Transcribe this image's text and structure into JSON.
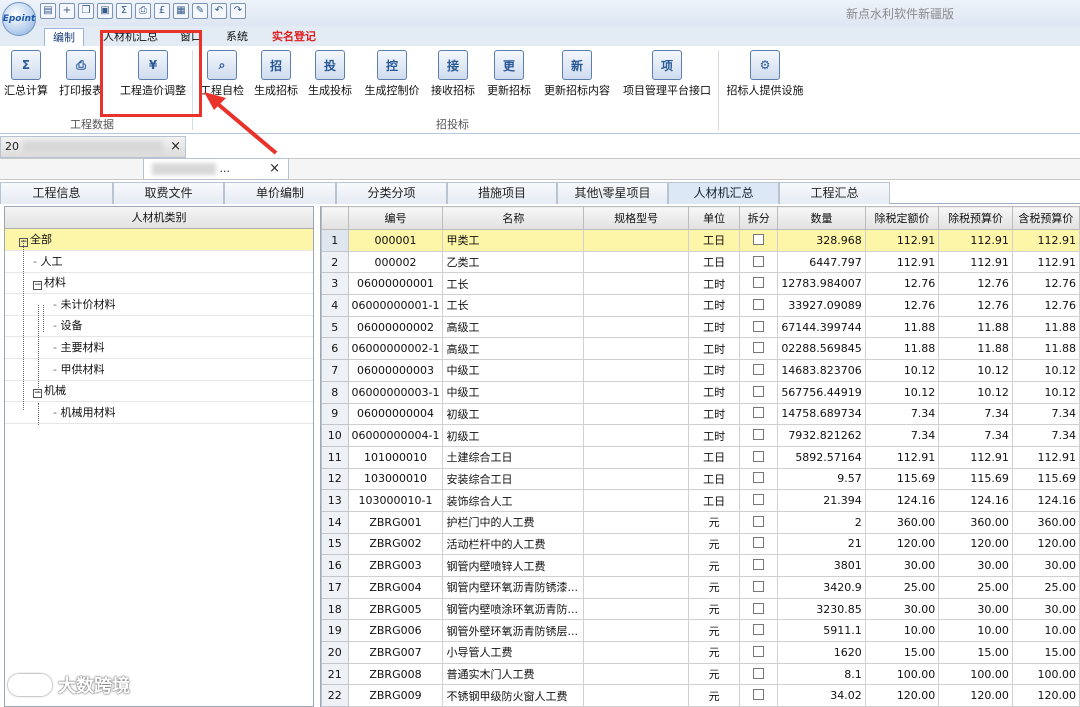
{
  "app": {
    "logo_text": "Epoint",
    "title": "新点水利软件新疆版"
  },
  "quick_access": [
    "new-doc-icon",
    "add-icon",
    "open-icon",
    "save-icon",
    "sum-icon",
    "print-icon",
    "money-icon",
    "calc-icon",
    "edit-icon",
    "undo-icon",
    "redo-icon"
  ],
  "ribbon_tabs": [
    {
      "label": "编制",
      "active": true
    },
    {
      "label": "人材机汇总"
    },
    {
      "label": "窗口"
    },
    {
      "label": "系统"
    },
    {
      "label": "实名登记",
      "highlight": "#e02020"
    }
  ],
  "ribbon": {
    "buttons": [
      {
        "label": "汇总计算",
        "glyph": "Σ"
      },
      {
        "label": "打印报表",
        "glyph": "⎙"
      },
      {
        "label": "工程造价调整",
        "glyph": "¥"
      },
      {
        "label": "工程自检",
        "glyph": "⌕"
      },
      {
        "label": "生成招标",
        "glyph": "招"
      },
      {
        "label": "生成投标",
        "glyph": "投"
      },
      {
        "label": "生成控制价",
        "glyph": "控"
      },
      {
        "label": "接收招标",
        "glyph": "接"
      },
      {
        "label": "更新招标",
        "glyph": "更"
      },
      {
        "label": "更新招标内容",
        "glyph": "新"
      },
      {
        "label": "项目管理平台接口",
        "glyph": "项"
      },
      {
        "label": "招标人提供设施",
        "glyph": "⚙"
      }
    ],
    "groups": [
      "工程数据",
      "招投标"
    ]
  },
  "doc_tabs": [
    {
      "label_prefix": "20",
      "close": "×"
    },
    {
      "label_suffix": "...",
      "close": "×"
    }
  ],
  "main_tabs": [
    {
      "label": "工程信息"
    },
    {
      "label": "取费文件"
    },
    {
      "label": "单价编制"
    },
    {
      "label": "分类分项"
    },
    {
      "label": "措施项目"
    },
    {
      "label": "其他\\零星项目"
    },
    {
      "label": "人材机汇总",
      "active": true
    },
    {
      "label": "工程汇总"
    }
  ],
  "tree": {
    "header": "人材机类别",
    "nodes": [
      {
        "label": "全部",
        "selected": true,
        "expander": "−"
      },
      {
        "label": "人工"
      },
      {
        "label": "材料",
        "expander": "−"
      },
      {
        "label": "未计价材料"
      },
      {
        "label": "设备"
      },
      {
        "label": "主要材料"
      },
      {
        "label": "甲供材料"
      },
      {
        "label": "机械",
        "expander": "−"
      },
      {
        "label": "机械用材料"
      }
    ]
  },
  "grid": {
    "columns": [
      "",
      "编号",
      "名称",
      "规格型号",
      "单位",
      "拆分",
      "数量",
      "除税定额价",
      "除税预算价",
      "含税预算价"
    ],
    "rows": [
      [
        "1",
        "000001",
        "甲类工",
        "",
        "工日",
        "",
        "328.968",
        "112.91",
        "112.91",
        "112.91"
      ],
      [
        "2",
        "000002",
        "乙类工",
        "",
        "工日",
        "",
        "6447.797",
        "112.91",
        "112.91",
        "112.91"
      ],
      [
        "3",
        "06000000001",
        "工长",
        "",
        "工时",
        "",
        "12783.984007",
        "12.76",
        "12.76",
        "12.76"
      ],
      [
        "4",
        "06000000001-1",
        "工长",
        "",
        "工时",
        "",
        "33927.09089",
        "12.76",
        "12.76",
        "12.76"
      ],
      [
        "5",
        "06000000002",
        "高级工",
        "",
        "工时",
        "",
        "67144.399744",
        "11.88",
        "11.88",
        "11.88"
      ],
      [
        "6",
        "06000000002-1",
        "高级工",
        "",
        "工时",
        "",
        "02288.569845",
        "11.88",
        "11.88",
        "11.88"
      ],
      [
        "7",
        "06000000003",
        "中级工",
        "",
        "工时",
        "",
        "14683.823706",
        "10.12",
        "10.12",
        "10.12"
      ],
      [
        "8",
        "06000000003-1",
        "中级工",
        "",
        "工时",
        "",
        "567756.44919",
        "10.12",
        "10.12",
        "10.12"
      ],
      [
        "9",
        "06000000004",
        "初级工",
        "",
        "工时",
        "",
        "14758.689734",
        "7.34",
        "7.34",
        "7.34"
      ],
      [
        "10",
        "06000000004-1",
        "初级工",
        "",
        "工时",
        "",
        "7932.821262",
        "7.34",
        "7.34",
        "7.34"
      ],
      [
        "11",
        "101000010",
        "土建综合工日",
        "",
        "工日",
        "",
        "5892.57164",
        "112.91",
        "112.91",
        "112.91"
      ],
      [
        "12",
        "103000010",
        "安装综合工日",
        "",
        "工日",
        "",
        "9.57",
        "115.69",
        "115.69",
        "115.69"
      ],
      [
        "13",
        "103000010-1",
        "装饰综合人工",
        "",
        "工日",
        "",
        "21.394",
        "124.16",
        "124.16",
        "124.16"
      ],
      [
        "14",
        "ZBRG001",
        "护栏门中的人工费",
        "",
        "元",
        "",
        "2",
        "360.00",
        "360.00",
        "360.00"
      ],
      [
        "15",
        "ZBRG002",
        "活动栏杆中的人工费",
        "",
        "元",
        "",
        "21",
        "120.00",
        "120.00",
        "120.00"
      ],
      [
        "16",
        "ZBRG003",
        "钢管内壁喷锌人工费",
        "",
        "元",
        "",
        "3801",
        "30.00",
        "30.00",
        "30.00"
      ],
      [
        "17",
        "ZBRG004",
        "钢管内壁环氧沥青防锈漆...",
        "",
        "元",
        "",
        "3420.9",
        "25.00",
        "25.00",
        "25.00"
      ],
      [
        "18",
        "ZBRG005",
        "钢管内壁喷涂环氧沥青防...",
        "",
        "元",
        "",
        "3230.85",
        "30.00",
        "30.00",
        "30.00"
      ],
      [
        "19",
        "ZBRG006",
        "钢管外壁环氧沥青防锈层...",
        "",
        "元",
        "",
        "5911.1",
        "10.00",
        "10.00",
        "10.00"
      ],
      [
        "20",
        "ZBRG007",
        "小导管人工费",
        "",
        "元",
        "",
        "1620",
        "15.00",
        "15.00",
        "15.00"
      ],
      [
        "21",
        "ZBRG008",
        "普通实木门人工费",
        "",
        "元",
        "",
        "8.1",
        "100.00",
        "100.00",
        "100.00"
      ],
      [
        "22",
        "ZBRG009",
        "不锈钢甲级防火窗人工费",
        "",
        "元",
        "",
        "34.02",
        "120.00",
        "120.00",
        "120.00"
      ]
    ]
  },
  "watermark": "大数跨境",
  "colors": {
    "selected_row": "#fdf5a8",
    "highlight_box": "#e8322a",
    "ribbon_border": "#5b7fae"
  }
}
